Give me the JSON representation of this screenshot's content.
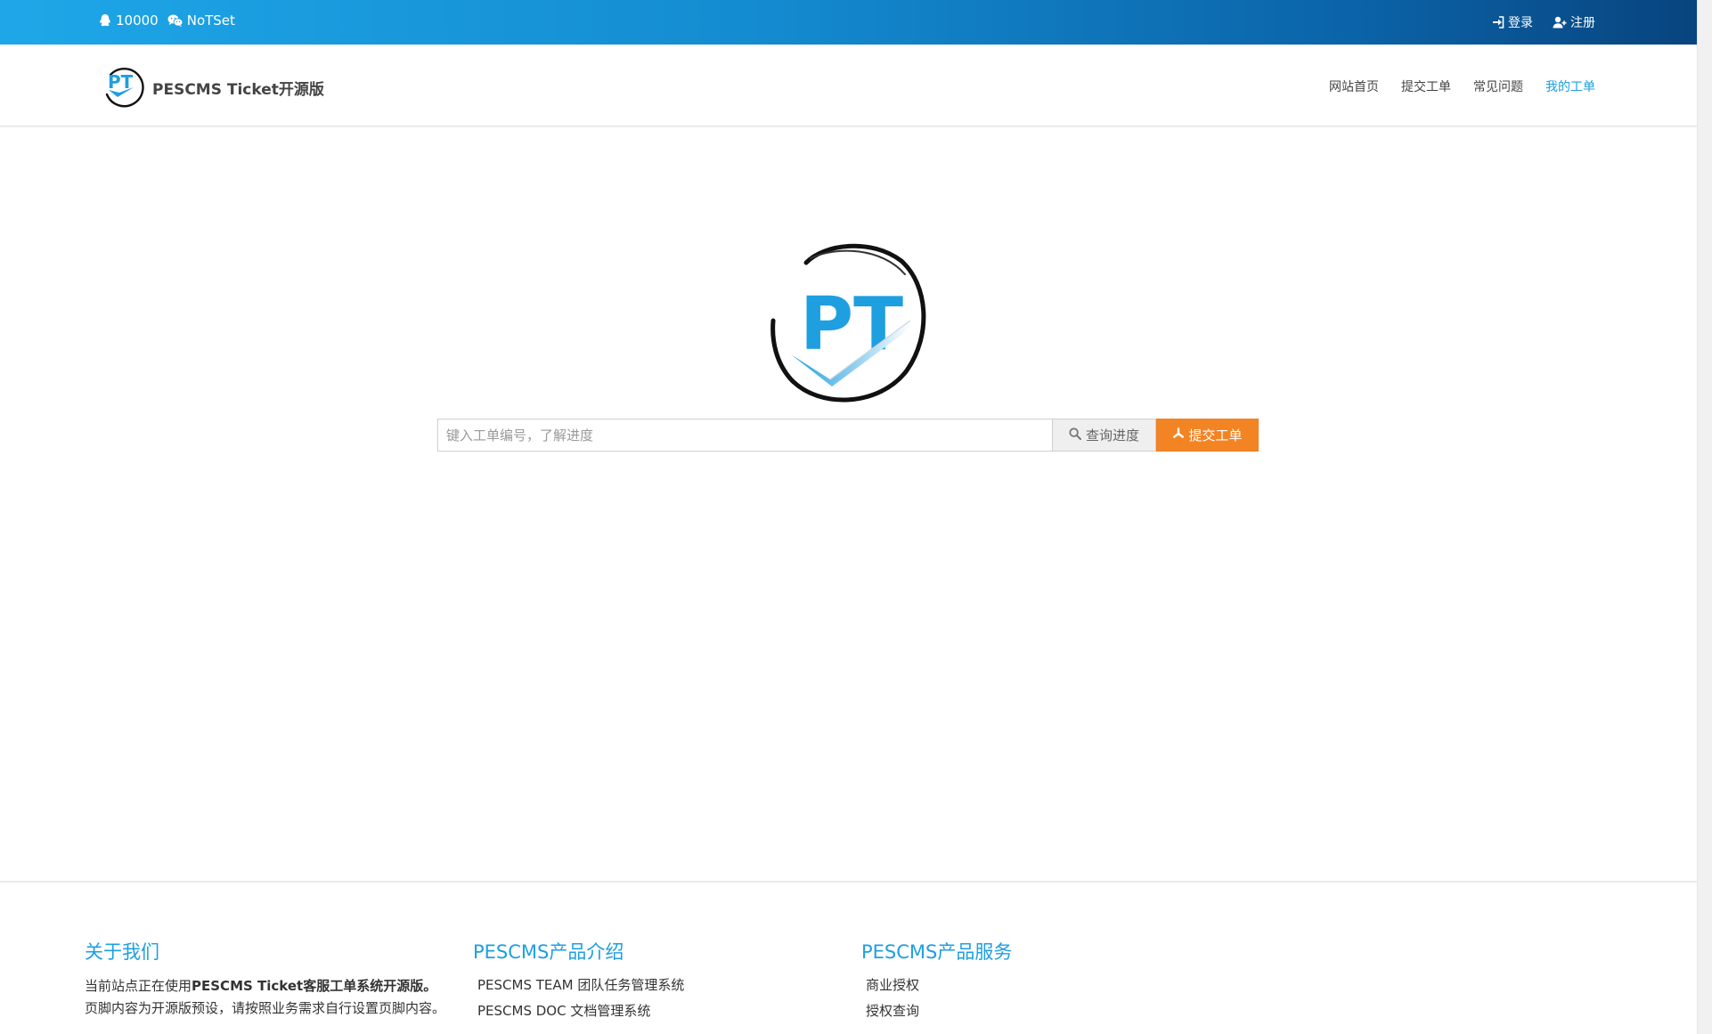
{
  "topbar": {
    "qq": "10000",
    "wechat": "NoTSet",
    "login": "登录",
    "register": "注册",
    "gradient_start": "#1ea7e8",
    "gradient_end": "#08447e"
  },
  "brand": {
    "name": "PESCMS Ticket开源版",
    "logo_letters": "PT"
  },
  "nav": {
    "items": [
      "网站首页",
      "提交工单",
      "常见问题",
      "我的工单"
    ],
    "active": "我的工单",
    "active_color": "#1e9fe0"
  },
  "hero": {
    "logo_letters": "PT",
    "search_placeholder": "键入工单编号，了解进度",
    "query_button": "查询进度",
    "submit_button": "提交工单",
    "submit_color": "#f38424"
  },
  "footer": {
    "about_title": "关于我们",
    "about_text_prefix": "当前站点正在使用",
    "about_text_bold": "PESCMS Ticket客服工单系统开源版。",
    "about_text_rest": "页脚内容为开源版预设，请按照业务需求自行设置页脚内容。",
    "products_title": "PESCMS产品介绍",
    "products": [
      "PESCMS TEAM 团队任务管理系统",
      "PESCMS DOC 文档管理系统"
    ],
    "services_title": "PESCMS产品服务",
    "services": [
      "商业授权",
      "授权查询"
    ]
  },
  "icons": {
    "qq": "qq-penguin-icon",
    "wechat": "wechat-icon",
    "login": "sign-in-icon",
    "register": "user-plus-icon",
    "search": "search-icon",
    "submit": "asterisk-icon"
  }
}
